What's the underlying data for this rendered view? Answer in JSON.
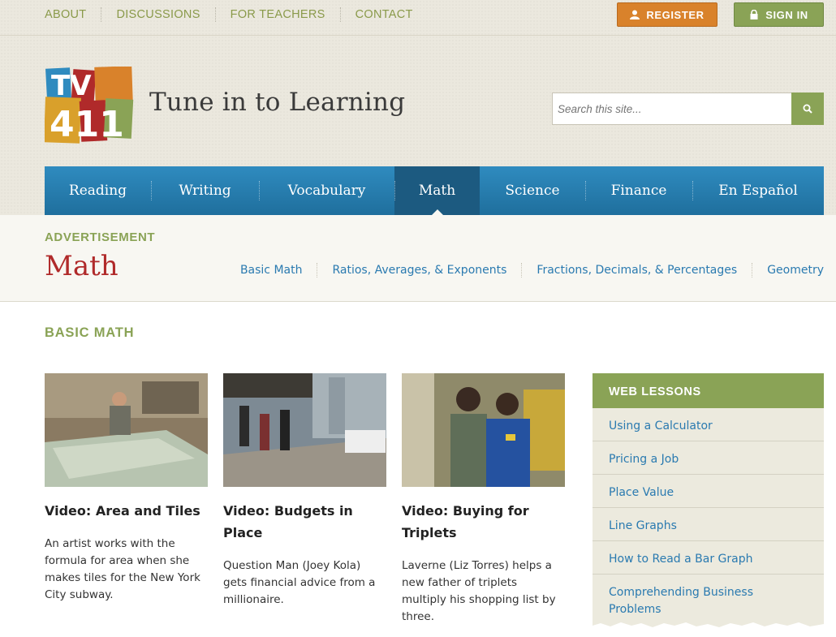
{
  "topbar": {
    "links": [
      "ABOUT",
      "DISCUSSIONS",
      "FOR TEACHERS",
      "CONTACT"
    ],
    "register_label": "REGISTER",
    "signin_label": "SIGN IN",
    "colors": {
      "register": "#d9822b",
      "signin": "#8aa356"
    }
  },
  "header": {
    "logo_text": "TV411",
    "site_title": "Tune in to Learning",
    "search_placeholder": "Search this site..."
  },
  "nav": {
    "items": [
      "Reading",
      "Writing",
      "Vocabulary",
      "Math",
      "Science",
      "Finance",
      "En Español"
    ],
    "active": "Math",
    "color": "#2f8bbf"
  },
  "subheader": {
    "ad_label": "ADVERTISEMENT",
    "section_title": "Math",
    "links": [
      "Basic Math",
      "Ratios, Averages, & Exponents",
      "Fractions, Decimals, & Percentages",
      "Geometry"
    ]
  },
  "content": {
    "heading": "BASIC MATH",
    "cards": [
      {
        "title": "Video: Area and Tiles",
        "description": "An artist works with the formula for area when she makes tiles for the New York City subway."
      },
      {
        "title": "Video: Budgets in Place",
        "description": "Question Man (Joey Kola) gets financial advice from a millionaire."
      },
      {
        "title": "Video: Buying for Triplets",
        "description": "Laverne (Liz Torres) helps a new father of triplets multiply his shopping list by three."
      }
    ]
  },
  "sidebar": {
    "heading": "WEB LESSONS",
    "items": [
      "Using a Calculator",
      "Pricing a Job",
      "Place Value",
      "Line Graphs",
      "How to Read a Bar Graph",
      "Comprehending Business Problems"
    ]
  }
}
